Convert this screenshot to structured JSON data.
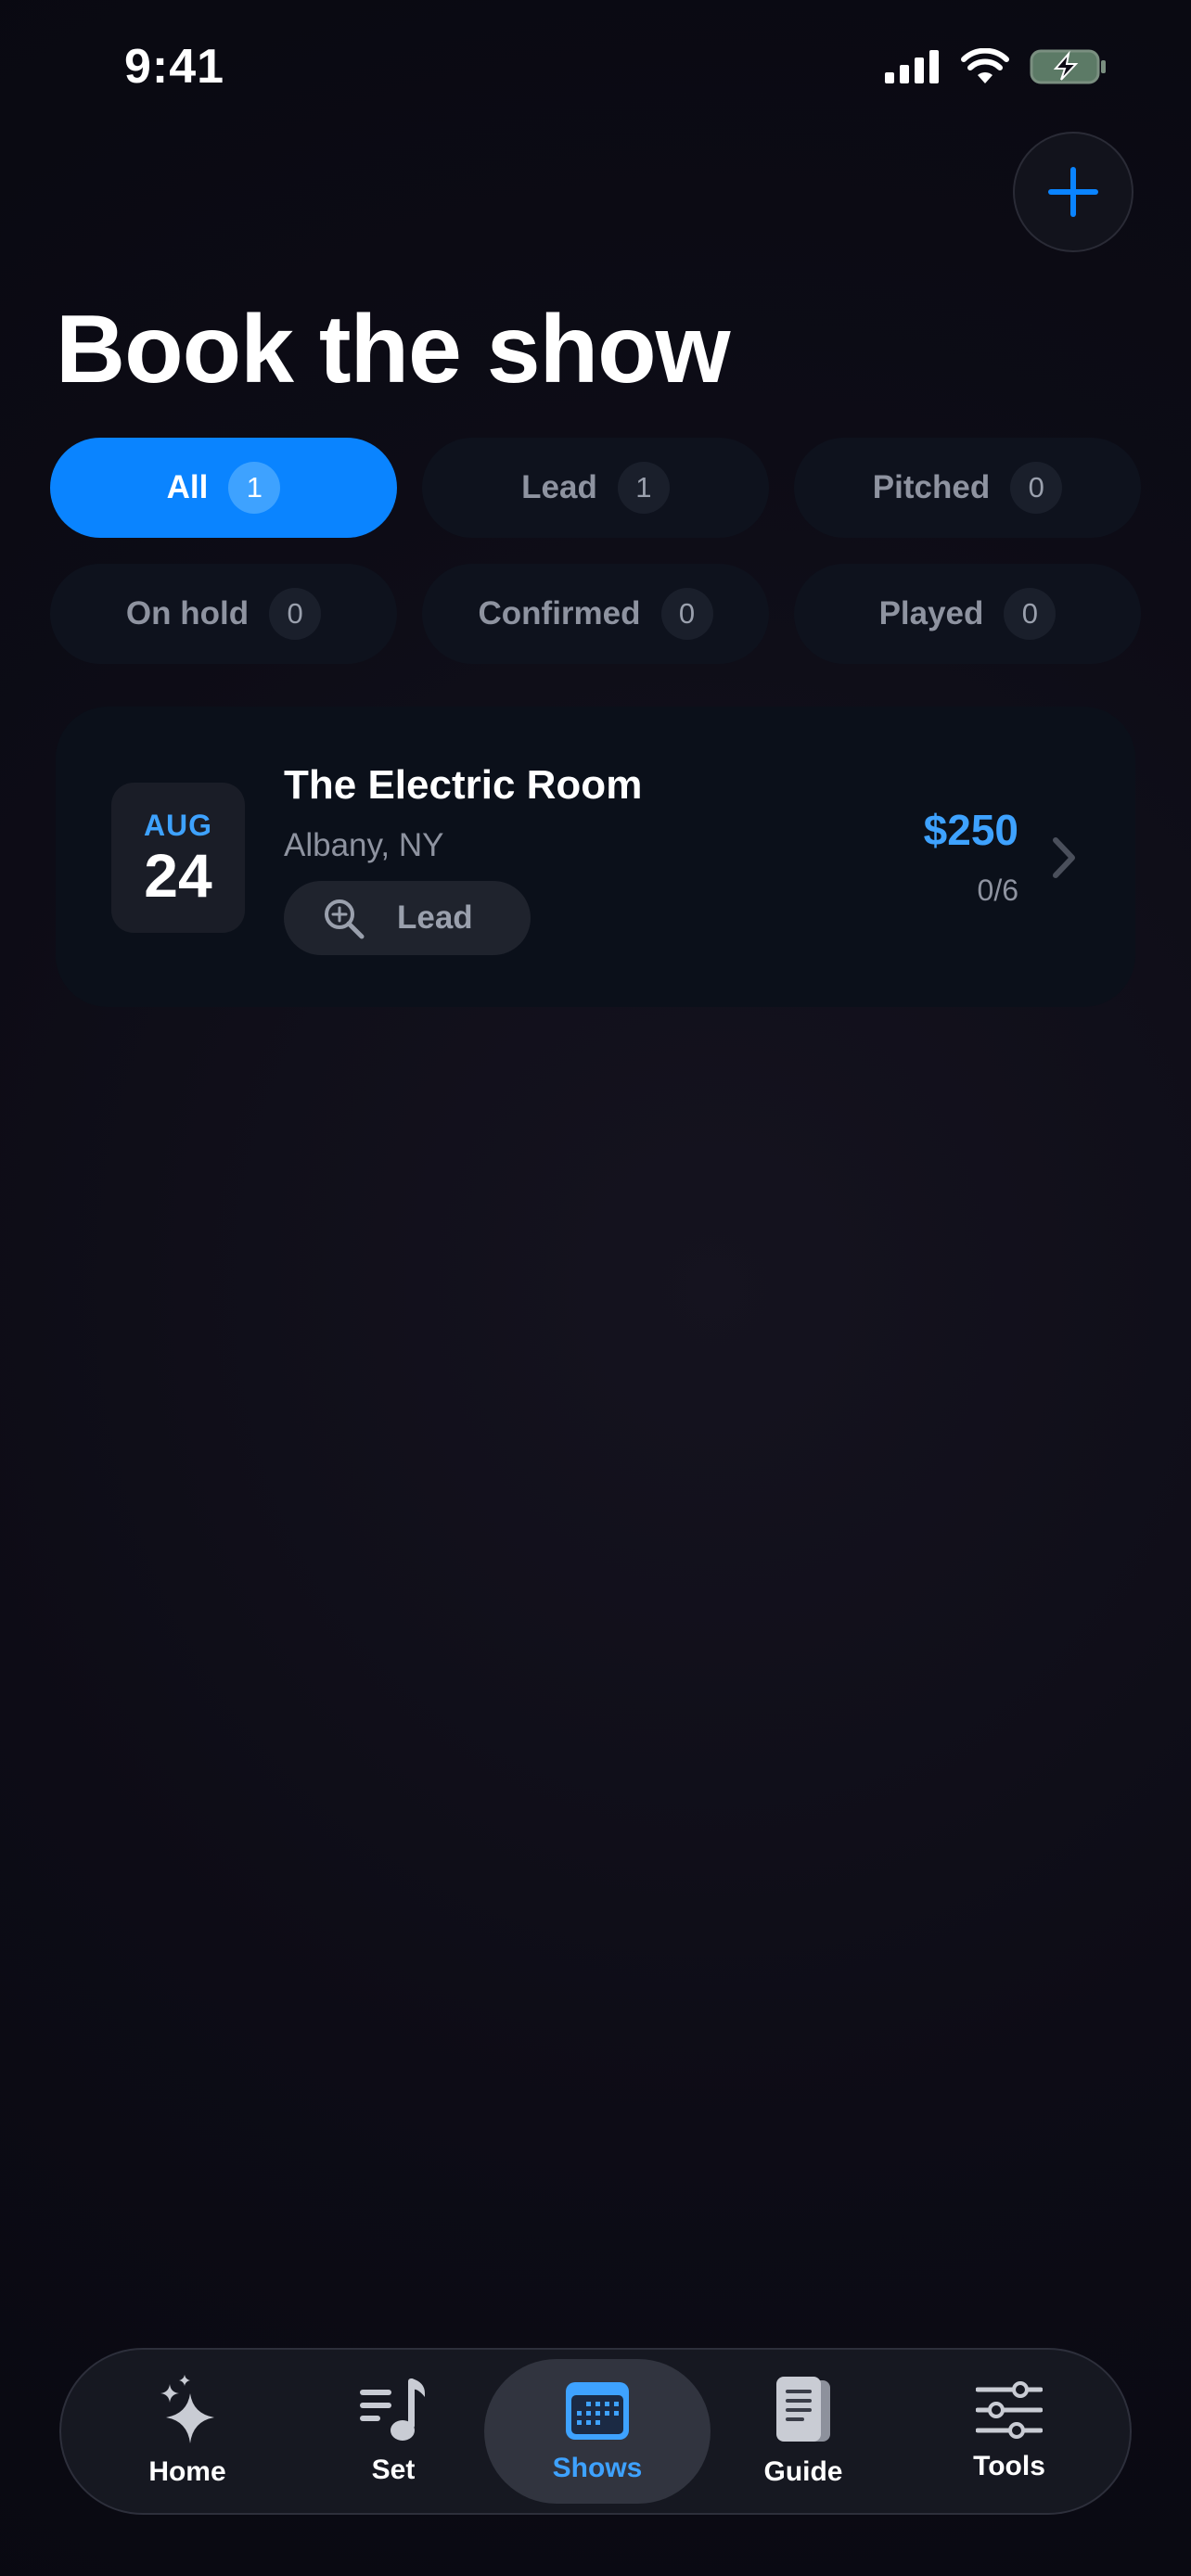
{
  "status_bar": {
    "time": "9:41"
  },
  "header": {
    "title": "Book the show",
    "add_icon": "plus-icon"
  },
  "filters": [
    {
      "label": "All",
      "count": "1",
      "active": true
    },
    {
      "label": "Lead",
      "count": "1",
      "active": false
    },
    {
      "label": "Pitched",
      "count": "0",
      "active": false
    },
    {
      "label": "On hold",
      "count": "0",
      "active": false
    },
    {
      "label": "Confirmed",
      "count": "0",
      "active": false
    },
    {
      "label": "Played",
      "count": "0",
      "active": false
    }
  ],
  "shows": [
    {
      "month": "AUG",
      "day": "24",
      "venue": "The Electric Room",
      "city": "Albany, NY",
      "status": "Lead",
      "status_icon": "magnifier-plus-icon",
      "price": "$250",
      "progress": "0/6"
    }
  ],
  "tabbar": [
    {
      "label": "Home",
      "icon": "sparkles-icon"
    },
    {
      "label": "Set",
      "icon": "music-list-icon"
    },
    {
      "label": "Shows",
      "icon": "calendar-icon",
      "active": true
    },
    {
      "label": "Guide",
      "icon": "book-icon"
    },
    {
      "label": "Tools",
      "icon": "sliders-icon"
    }
  ],
  "colors": {
    "accent": "#0a84ff",
    "accent_text": "#3ea2ff",
    "background": "#0d0c16"
  }
}
